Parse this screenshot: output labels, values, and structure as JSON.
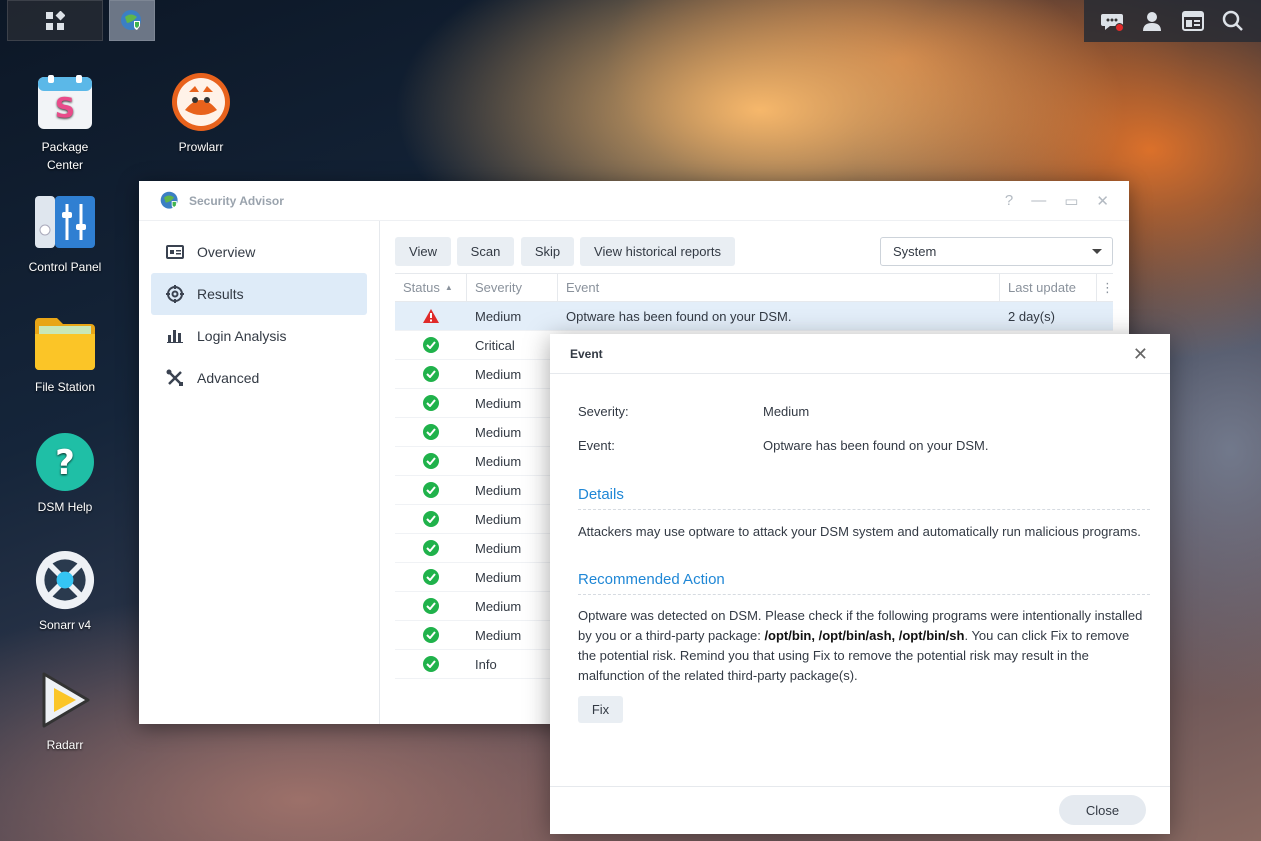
{
  "desktop": {
    "icons": [
      {
        "label": "Package\nCenter"
      },
      {
        "label": "Prowlarr"
      },
      {
        "label": "Control Panel"
      },
      {
        "label": "File Station"
      },
      {
        "label": "DSM Help"
      },
      {
        "label": "Sonarr v4"
      },
      {
        "label": "Radarr"
      }
    ]
  },
  "window": {
    "title": "Security Advisor",
    "sidebar": [
      {
        "label": "Overview",
        "icon": "overview-icon"
      },
      {
        "label": "Results",
        "icon": "results-icon"
      },
      {
        "label": "Login Analysis",
        "icon": "chart-icon"
      },
      {
        "label": "Advanced",
        "icon": "tools-icon"
      }
    ],
    "toolbar": {
      "view": "View",
      "scan": "Scan",
      "skip": "Skip",
      "history": "View historical reports",
      "filter": "System"
    },
    "grid": {
      "headers": {
        "status": "Status",
        "severity": "Severity",
        "event": "Event",
        "last_update": "Last update"
      },
      "rows": [
        {
          "status": "warning",
          "severity": "Medium",
          "event": "Optware has been found on your DSM.",
          "last_update": "2 day(s)"
        },
        {
          "status": "ok",
          "severity": "Critical",
          "event": "",
          "last_update": ""
        },
        {
          "status": "ok",
          "severity": "Medium",
          "event": "",
          "last_update": ""
        },
        {
          "status": "ok",
          "severity": "Medium",
          "event": "",
          "last_update": ""
        },
        {
          "status": "ok",
          "severity": "Medium",
          "event": "",
          "last_update": ""
        },
        {
          "status": "ok",
          "severity": "Medium",
          "event": "",
          "last_update": ""
        },
        {
          "status": "ok",
          "severity": "Medium",
          "event": "",
          "last_update": ""
        },
        {
          "status": "ok",
          "severity": "Medium",
          "event": "",
          "last_update": ""
        },
        {
          "status": "ok",
          "severity": "Medium",
          "event": "",
          "last_update": ""
        },
        {
          "status": "ok",
          "severity": "Medium",
          "event": "",
          "last_update": ""
        },
        {
          "status": "ok",
          "severity": "Medium",
          "event": "",
          "last_update": ""
        },
        {
          "status": "ok",
          "severity": "Medium",
          "event": "",
          "last_update": ""
        },
        {
          "status": "ok",
          "severity": "Info",
          "event": "",
          "last_update": ""
        }
      ]
    }
  },
  "modal": {
    "title": "Event",
    "severity_label": "Severity:",
    "severity_value": "Medium",
    "event_label": "Event:",
    "event_value": "Optware has been found on your DSM.",
    "details_title": "Details",
    "details_text": "Attackers may use optware to attack your DSM system and automatically run malicious programs.",
    "action_title": "Recommended Action",
    "action_text_1": "Optware was detected on DSM. Please check if the following programs were intentionally installed by you or a third-party package: ",
    "action_paths": "/opt/bin, /opt/bin/ash, /opt/bin/sh",
    "action_text_2": ". You can click Fix to remove the potential risk. Remind you that using Fix to remove the potential risk may result in the malfunction of the related third-party package(s).",
    "fix": "Fix",
    "close": "Close"
  },
  "colors": {
    "accent": "#1f87d6",
    "ok": "#20b24b",
    "warning": "#e02a2a",
    "selection": "#deebf8"
  }
}
